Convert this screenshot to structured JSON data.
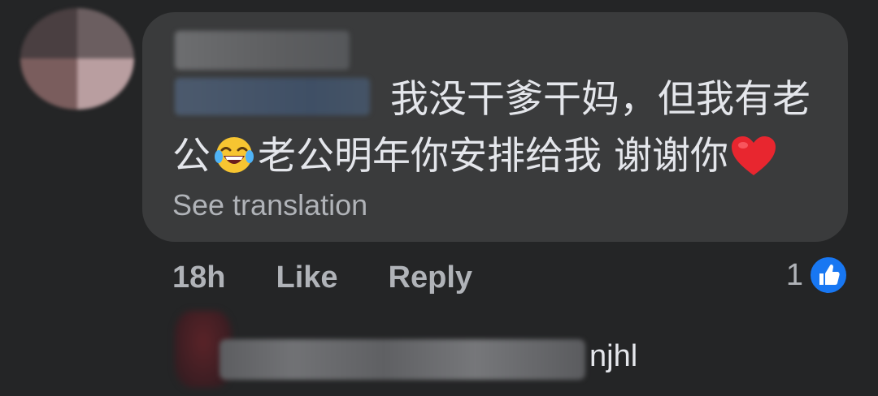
{
  "comment": {
    "line1": "我没干爹干妈，但我有老",
    "line2_before": "公",
    "line2_middle": "老公明年你安排给我 谢谢你",
    "laugh_emoji": "face-with-tears-of-joy-icon",
    "heart_emoji": "red-heart-icon",
    "see_translation": "See translation"
  },
  "actions": {
    "time": "18h",
    "like": "Like",
    "reply": "Reply",
    "reaction_count": "1",
    "reaction_icon": "thumbs-up-icon"
  },
  "reply_preview": {
    "name_suffix": "njhl"
  },
  "colors": {
    "background": "#242526",
    "bubble": "#3a3b3c",
    "text": "#e4e6eb",
    "secondary_text": "#b0b3b8",
    "like_blue": "#1877f2"
  }
}
